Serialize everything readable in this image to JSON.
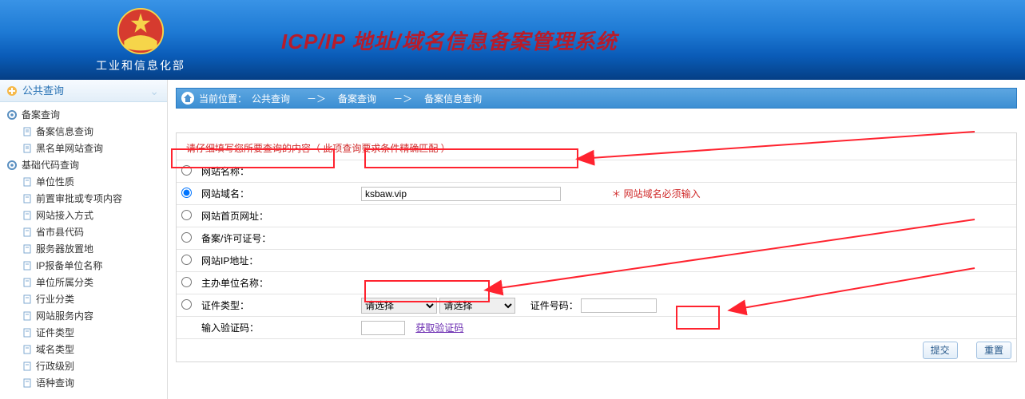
{
  "header": {
    "dept": "工业和信息化部",
    "title": "ICP/IP 地址/域名信息备案管理系统"
  },
  "sidebar": {
    "header": "公共查询",
    "group1": {
      "title": "备案查询",
      "items": [
        "备案信息查询",
        "黑名单网站查询"
      ]
    },
    "group2": {
      "title": "基础代码查询",
      "items": [
        "单位性质",
        "前置审批或专项内容",
        "网站接入方式",
        "省市县代码",
        "服务器放置地",
        "IP报备单位名称",
        "单位所属分类",
        "行业分类",
        "网站服务内容",
        "证件类型",
        "域名类型",
        "行政级别",
        "语种查询"
      ]
    }
  },
  "breadcrumb": {
    "loc_label": "当前位置：",
    "a": "公共查询",
    "sep": "－＞",
    "b": "备案查询",
    "c": "备案信息查询"
  },
  "form": {
    "hint": "请仔细填写您所要查询的内容（ 此项查询要求条件精确匹配 ）",
    "rows": {
      "r0": "网站名称：",
      "r1": "网站域名：",
      "r2": "网站首页网址：",
      "r3": "备案/许可证号：",
      "r4": "网站IP地址：",
      "r5": "主办单位名称：",
      "r6": "证件类型：",
      "captcha": "输入验证码："
    },
    "domain_value": "ksbaw.vip",
    "domain_note": "＊ 网站域名必须输入",
    "select_placeholder": "请选择",
    "cert_no_label": "证件号码：",
    "captcha_link": "获取验证码",
    "submit": "提交",
    "reset": "重置"
  }
}
